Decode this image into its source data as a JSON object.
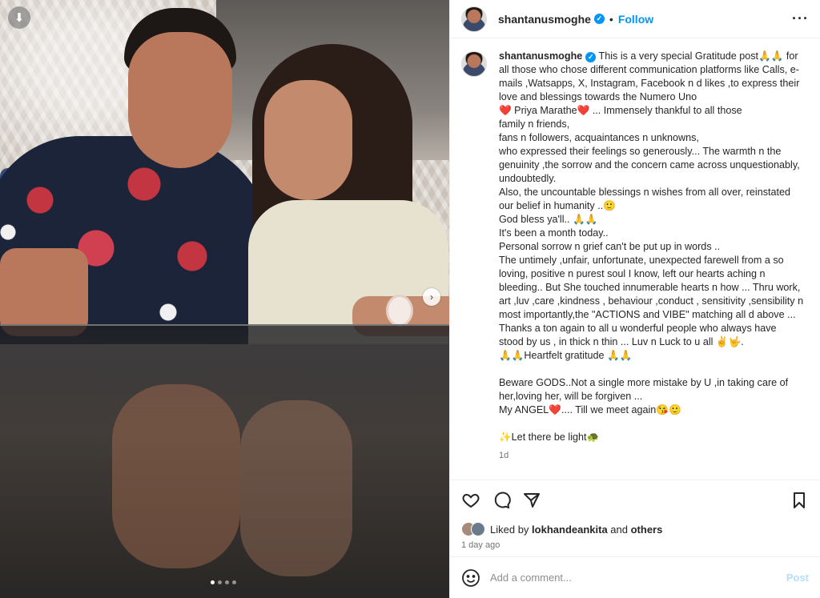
{
  "post": {
    "username": "shantanusmoghe",
    "separator": "•",
    "follow_label": "Follow",
    "more_label": "···",
    "verified_glyph": "✓"
  },
  "photo": {
    "download_glyph": "⬇",
    "next_glyph": "›",
    "carousel_count": 4,
    "carousel_active": 1
  },
  "caption": {
    "username": "shantanusmoghe",
    "lines": [
      "This is a very special Gratitude post🙏🙏 for",
      "all those who chose different communication platforms like Calls, e-",
      "mails ,Watsapps, X, Instagram, Facebook n d likes ,to express their",
      "love and blessings towards the Numero Uno",
      "❤️ Priya Marathe❤️ ... Immensely thankful to all those",
      "family n friends,",
      "fans n followers, acquaintances n unknowns,",
      "who expressed their feelings so generously... The warmth n the",
      "genuinity ,the sorrow and the concern came across unquestionably,",
      "undoubtedly.",
      "Also, the uncountable blessings n wishes from all over, reinstated",
      "our belief in humanity ..🙂",
      "God bless ya'll.. 🙏🙏",
      "It's been a month today..",
      "Personal sorrow n grief can't be put up in words ..",
      "The untimely ,unfair, unfortunate, unexpected farewell from a so",
      "loving, positive n purest soul I know, left our hearts aching n",
      "bleeding.. But She touched innumerable hearts n how ... Thru work,",
      "art ,luv ,care ,kindness , behaviour ,conduct , sensitivity ,sensibility n",
      "most importantly,the \"ACTIONS and VIBE\" matching all d above ...",
      "Thanks a ton again to all u wonderful people who always have",
      "stood by us , in thick n thin ... Luv n Luck to u all ✌️🤟.",
      "🙏🙏Heartfelt gratitude 🙏🙏",
      "",
      "Beware GODS..Not a single more mistake by U ,in taking care of",
      "her,loving her, will be forgiven ...",
      "My ANGEL❤️.... Till we meet again😘🙂",
      "",
      "✨Let there be light🐢"
    ],
    "time": "1d"
  },
  "actions": {
    "like_icon": "heart-outline-icon",
    "comment_icon": "comment-bubble-icon",
    "share_icon": "paper-plane-icon",
    "save_icon": "bookmark-icon"
  },
  "likes": {
    "prefix": "Liked by ",
    "user": "lokhandeankita",
    "middle": " and ",
    "others": "others"
  },
  "posted_ago": "1 day ago",
  "comment": {
    "placeholder": "Add a comment...",
    "post_label": "Post",
    "emoji_icon": "smiley-icon"
  }
}
